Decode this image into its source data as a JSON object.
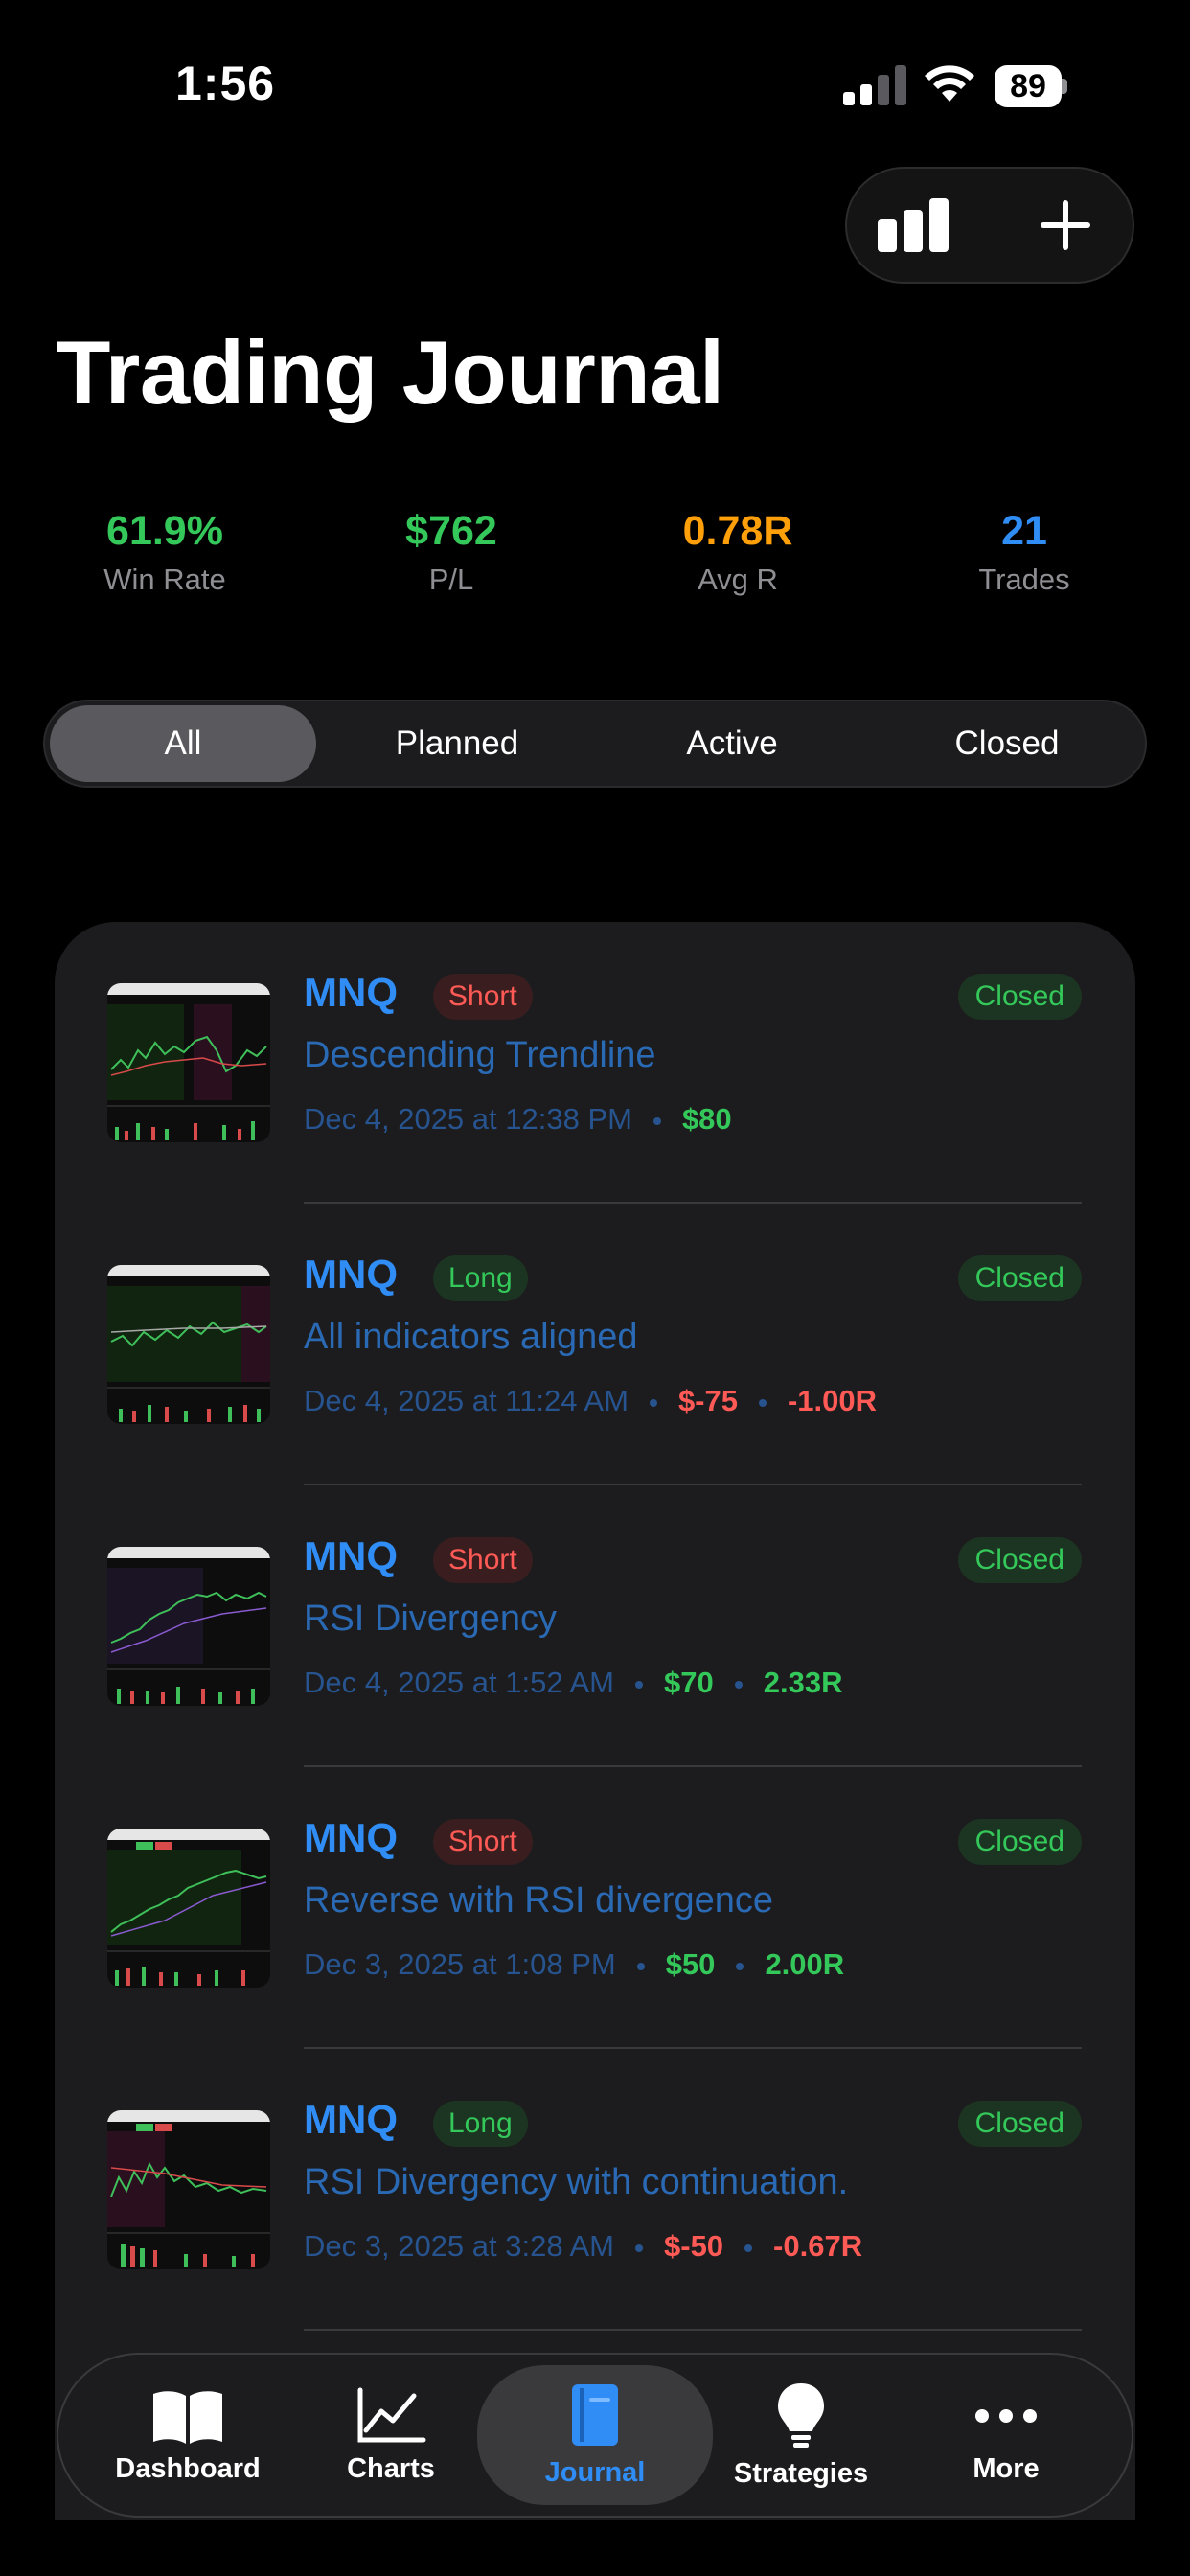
{
  "status_bar": {
    "time": "1:56",
    "battery": "89"
  },
  "title": "Trading Journal",
  "stats": [
    {
      "value": "61.9%",
      "label": "Win Rate",
      "color": "#34c759"
    },
    {
      "value": "$762",
      "label": "P/L",
      "color": "#34c759"
    },
    {
      "value": "0.78R",
      "label": "Avg R",
      "color": "#ff9f0a"
    },
    {
      "value": "21",
      "label": "Trades",
      "color": "#2f8df5"
    }
  ],
  "filters": {
    "all": "All",
    "planned": "Planned",
    "active": "Active",
    "closed": "Closed",
    "selected": "All"
  },
  "trades": [
    {
      "symbol": "MNQ",
      "direction": "Short",
      "status": "Closed",
      "setup": "Descending Trendline",
      "date": "Dec 4, 2025 at 12:38 PM",
      "pnl": "$80",
      "r": ""
    },
    {
      "symbol": "MNQ",
      "direction": "Long",
      "status": "Closed",
      "setup": "All indicators aligned",
      "date": "Dec 4, 2025 at 11:24 AM",
      "pnl": "$-75",
      "r": "-1.00R"
    },
    {
      "symbol": "MNQ",
      "direction": "Short",
      "status": "Closed",
      "setup": "RSI Divergency",
      "date": "Dec 4, 2025 at 1:52 AM",
      "pnl": "$70",
      "r": "2.33R"
    },
    {
      "symbol": "MNQ",
      "direction": "Short",
      "status": "Closed",
      "setup": "Reverse with RSI divergence",
      "date": "Dec 3, 2025 at 1:08 PM",
      "pnl": "$50",
      "r": "2.00R"
    },
    {
      "symbol": "MNQ",
      "direction": "Long",
      "status": "Closed",
      "setup": "RSI Divergency with continuation.",
      "date": "Dec 3, 2025 at 3:28 AM",
      "pnl": "$-50",
      "r": "-0.67R"
    }
  ],
  "tabs": [
    {
      "label": "Dashboard",
      "icon": "book-icon"
    },
    {
      "label": "Charts",
      "icon": "chart-line-icon"
    },
    {
      "label": "Journal",
      "icon": "journal-icon"
    },
    {
      "label": "Strategies",
      "icon": "lightbulb-icon"
    },
    {
      "label": "More",
      "icon": "ellipsis-icon"
    }
  ],
  "active_tab": "Journal",
  "colors": {
    "positive": "#34c759",
    "negative": "#ff5a55",
    "accent": "#2f8df5",
    "warning": "#ff9f0a"
  }
}
